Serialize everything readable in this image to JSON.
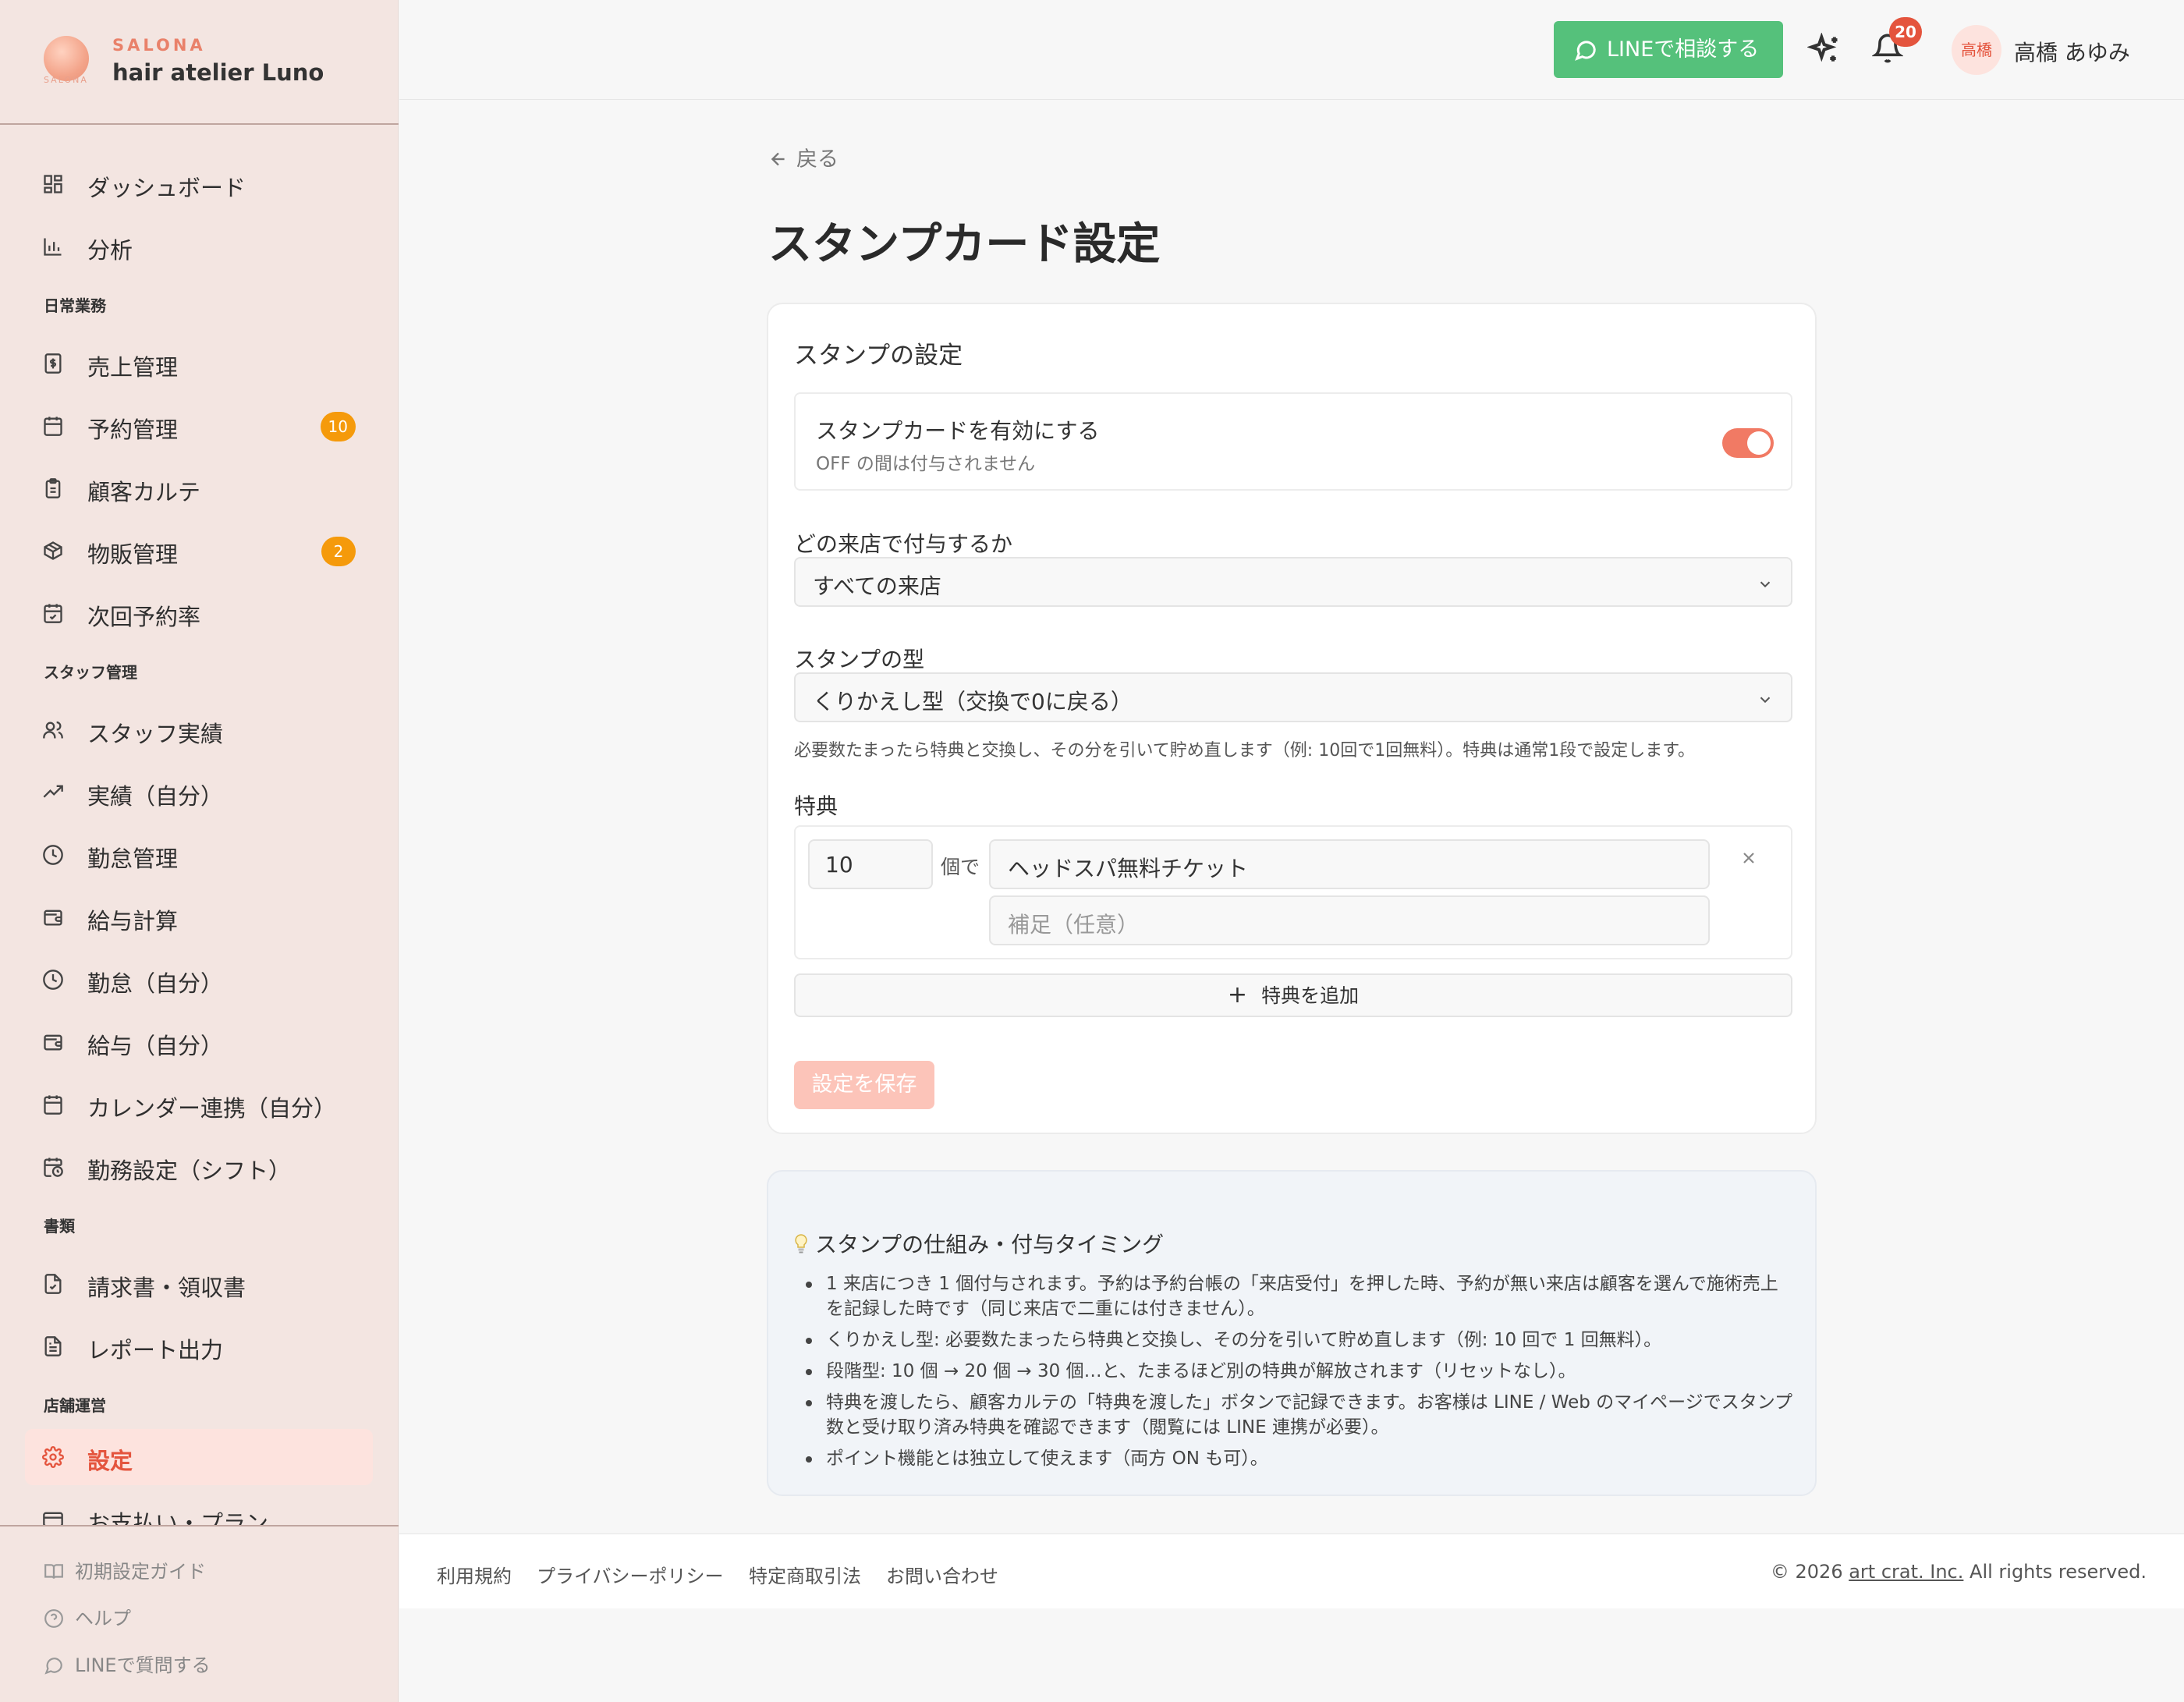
{
  "brand": {
    "kicker": "SALONA",
    "logo_sub": "SALONA",
    "name": "hair atelier Luno"
  },
  "nav": {
    "dashboard": "ダッシュボード",
    "analytics": "分析",
    "section_daily": "日常業務",
    "sales": "売上管理",
    "reservations": "予約管理",
    "reservations_badge": "10",
    "karte": "顧客カルテ",
    "products": "物販管理",
    "products_badge": "2",
    "next_rate": "次回予約率",
    "section_staff": "スタッフ管理",
    "staff_perf": "スタッフ実績",
    "my_perf": "実績（自分）",
    "attendance": "勤怠管理",
    "payroll": "給与計算",
    "my_attendance": "勤怠（自分）",
    "my_pay": "給与（自分）",
    "calendar": "カレンダー連携（自分）",
    "shift": "勤務設定（シフト）",
    "section_docs": "書類",
    "invoices": "請求書・領収書",
    "reports": "レポート出力",
    "section_store": "店舗運営",
    "settings": "設定",
    "billing": "お支払い・プラン"
  },
  "sidebar_footer": {
    "guide": "初期設定ガイド",
    "help": "ヘルプ",
    "line_question": "LINEで質問する"
  },
  "header": {
    "line_button": "LINEで相談する",
    "notification_count": "20",
    "avatar_initials": "高橋",
    "user_name": "高橋 あゆみ"
  },
  "main": {
    "back": "戻る",
    "title": "スタンプカード設定",
    "card_title": "スタンプの設定",
    "toggle_title": "スタンプカードを有効にする",
    "toggle_sub": "OFF の間は付与されません",
    "toggle_on": true,
    "grant_label": "どの来店で付与するか",
    "grant_value": "すべての来店",
    "type_label": "スタンプの型",
    "type_value": "くりかえし型（交換で0に戻る）",
    "type_help": "必要数たまったら特典と交換し、その分を引いて貯め直します（例: 10回で1回無料）。特典は通常1段で設定します。",
    "reward_label": "特典",
    "reward_count": "10",
    "reward_unit": "個で",
    "reward_name": "ヘッドスパ無料チケット",
    "reward_note_placeholder": "補足（任意）",
    "add_reward": "特典を追加",
    "save": "設定を保存"
  },
  "info": {
    "title": "スタンプの仕組み・付与タイミング",
    "items": [
      "1 来店につき 1 個付与されます。予約は予約台帳の「来店受付」を押した時、予約が無い来店は顧客を選んで施術売上を記録した時です（同じ来店で二重には付きません）。",
      "くりかえし型: 必要数たまったら特典と交換し、その分を引いて貯め直します（例: 10 回で 1 回無料）。",
      "段階型: 10 個 → 20 個 → 30 個…と、たまるほど別の特典が解放されます（リセットなし）。",
      "特典を渡したら、顧客カルテの「特典を渡した」ボタンで記録できます。お客様は LINE / Web のマイページでスタンプ数と受け取り済み特典を確認できます（閲覧には LINE 連携が必要）。",
      "ポイント機能とは独立して使えます（両方 ON も可）。"
    ]
  },
  "footer": {
    "terms": "利用規約",
    "privacy": "プライバシーポリシー",
    "commerce": "特定商取引法",
    "contact": "お問い合わせ",
    "copy_pre": "© 2026 ",
    "company": "art crat. Inc.",
    "copy_post": " All rights reserved."
  },
  "colors": {
    "accent": "#e4543d",
    "line_green": "#55c17b",
    "sidebar_bg": "#f3e5e1",
    "badge_orange": "#f59a0b"
  }
}
